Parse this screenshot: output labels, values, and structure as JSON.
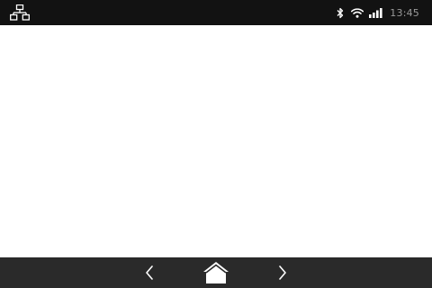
{
  "status_bar": {
    "left_icon": "network-icon",
    "icons": [
      "bluetooth-icon",
      "wifi-icon",
      "signal-icon"
    ],
    "time": "13:45",
    "colors": {
      "background": "#121212",
      "icon": "#ffffff",
      "time_text": "#9a9a9a"
    }
  },
  "content": {
    "background": "#ffffff"
  },
  "nav_bar": {
    "buttons": [
      "back-icon",
      "home-icon",
      "forward-icon"
    ],
    "colors": {
      "background": "#2a2a2a",
      "icon": "#ffffff"
    }
  }
}
